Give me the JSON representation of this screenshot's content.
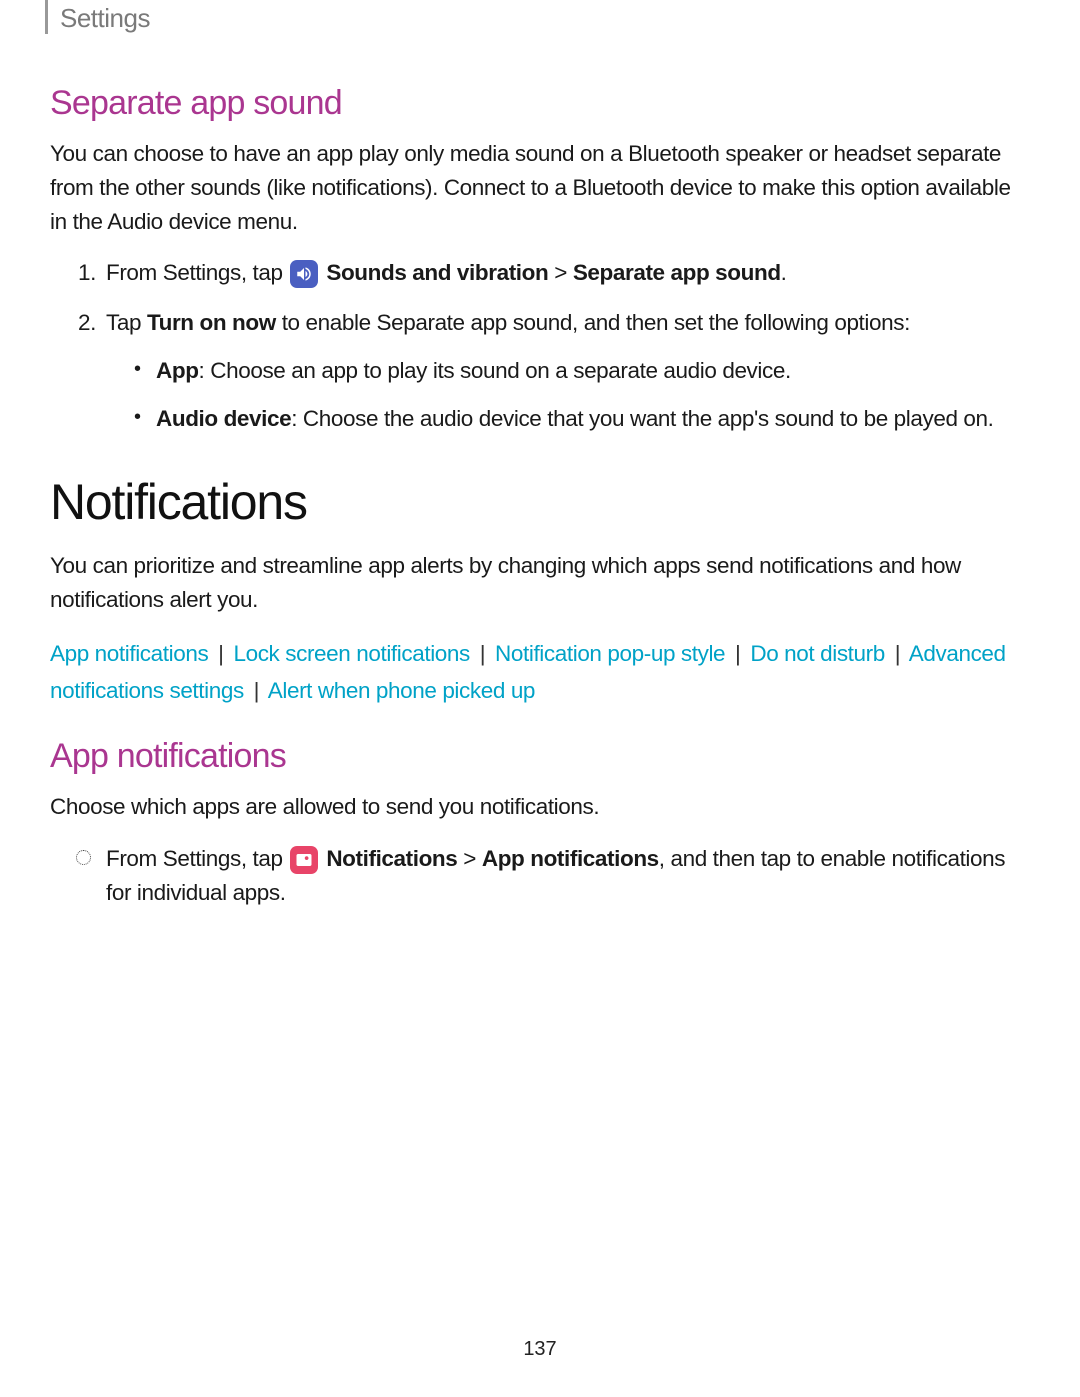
{
  "header": {
    "title": "Settings"
  },
  "s1": {
    "heading": "Separate app sound",
    "intro": "You can choose to have an app play only media sound on a Bluetooth speaker or headset separate from the other sounds (like notifications). Connect to a Bluetooth device to make this option available in the Audio device menu.",
    "step1_pre": "From Settings, tap ",
    "step1_bold1": " Sounds and vibration",
    "step1_breadcrumb": " > ",
    "step1_bold2": "Separate app sound",
    "step1_end": ".",
    "step2_pre": "Tap ",
    "step2_bold": "Turn on now",
    "step2_post": " to enable Separate app sound, and then set the following options:",
    "sub1_bold": "App",
    "sub1_text": ": Choose an app to play its sound on a separate audio device.",
    "sub2_bold": "Audio device",
    "sub2_text": ": Choose the audio device that you want the app's sound to be played on."
  },
  "s2": {
    "heading": "Notifications",
    "intro": "You can prioritize and streamline app alerts by changing which apps send notifications and how notifications alert you.",
    "links": {
      "a": "App notifications",
      "b": "Lock screen notifications",
      "c": "Notification pop-up style",
      "d": "Do not disturb",
      "e": "Advanced notifications settings",
      "f": "Alert when phone picked up"
    },
    "sep": "|"
  },
  "s3": {
    "heading": "App notifications",
    "intro": "Choose which apps are allowed to send you notifications.",
    "step_pre": "From Settings, tap ",
    "step_bold1": " Notifications",
    "step_breadcrumb": " > ",
    "step_bold2": "App notifications",
    "step_post": ", and then tap to enable notifications for individual apps."
  },
  "page_number": "137"
}
